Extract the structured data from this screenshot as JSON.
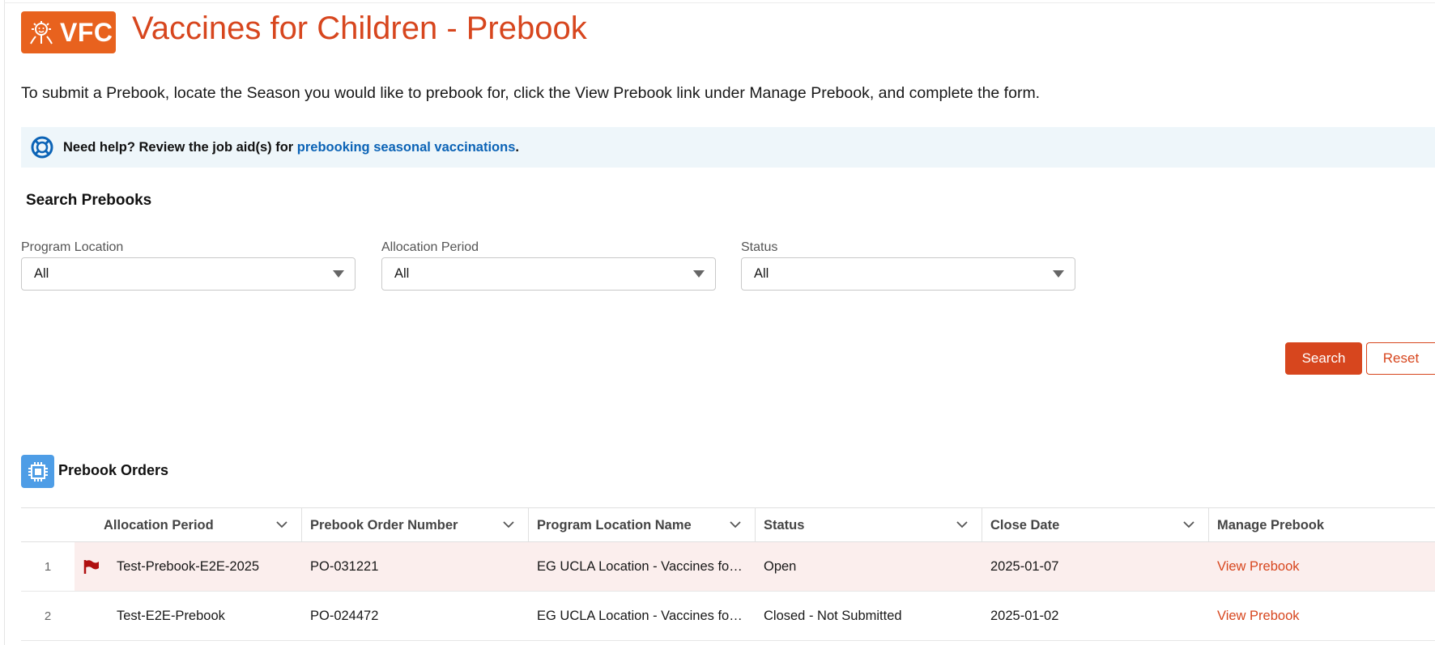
{
  "brand": {
    "logo_text": "VFC",
    "accent": "#e8621e",
    "title_color": "#d7461e"
  },
  "header": {
    "title": "Vaccines for Children - Prebook"
  },
  "intro": "To submit a Prebook, locate the Season you would like to prebook for, click the View Prebook link under Manage Prebook, and complete the form.",
  "help": {
    "icon": "lifebuoy-icon",
    "prefix": "Need help? Review the job aid(s) for ",
    "link": "prebooking seasonal vaccinations",
    "suffix": "."
  },
  "search": {
    "title": "Search Prebooks",
    "fields": [
      {
        "label": "Program Location",
        "value": "All"
      },
      {
        "label": "Allocation Period",
        "value": "All"
      },
      {
        "label": "Status",
        "value": "All"
      }
    ],
    "search_label": "Search",
    "reset_label": "Reset"
  },
  "orders": {
    "title": "Prebook Orders",
    "icon": "orders-icon",
    "columns": [
      "Allocation Period",
      "Prebook Order Number",
      "Program Location Name",
      "Status",
      "Close Date",
      "Manage Prebook"
    ],
    "rows": [
      {
        "num": "1",
        "flagged": true,
        "allocation_period": "Test-Prebook-E2E-2025",
        "order_number": "PO-031221",
        "location": "EG UCLA Location - Vaccines fo…",
        "status": "Open",
        "close_date": "2025-01-07",
        "action": "View Prebook"
      },
      {
        "num": "2",
        "flagged": false,
        "allocation_period": "Test-E2E-Prebook",
        "order_number": "PO-024472",
        "location": "EG UCLA Location - Vaccines fo…",
        "status": "Closed - Not Submitted",
        "close_date": "2025-01-02",
        "action": "View Prebook"
      }
    ]
  }
}
